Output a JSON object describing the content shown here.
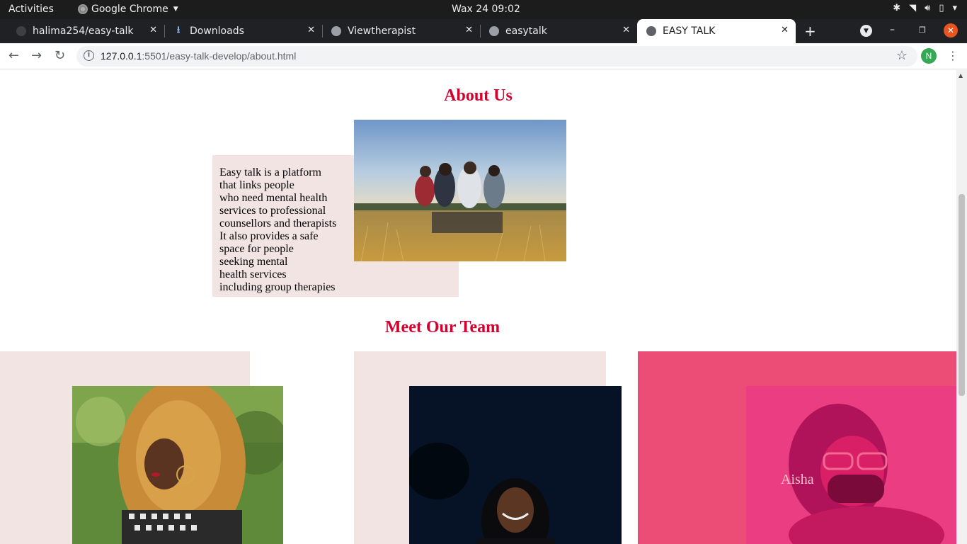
{
  "topbar": {
    "activities": "Activities",
    "app_name": "Google Chrome",
    "clock": "Wax 24  09:02"
  },
  "tabs": [
    {
      "title": "halima254/easy-talk",
      "icon": "github-icon"
    },
    {
      "title": "Downloads",
      "icon": "download-icon"
    },
    {
      "title": "Viewtherapist",
      "icon": "globe-icon"
    },
    {
      "title": "easytalk",
      "icon": "globe-icon"
    },
    {
      "title": "EASY TALK",
      "icon": "globe-icon",
      "active": true
    }
  ],
  "toolbar": {
    "url_host": "127.0.0.1",
    "url_rest": ":5501/easy-talk-develop/about.html",
    "profile_initial": "N"
  },
  "page": {
    "about_title": "About Us",
    "about_text": "Easy talk is a platform\nthat links people\nwho need mental health\nservices to professional\ncounsellors and therapists\nIt also provides a safe\nspace for people\nseeking mental\nhealth services\nincluding group therapies",
    "team_title": "Meet Our Team",
    "member_name": "Aisha"
  },
  "colors": {
    "accent": "#d6002e",
    "card_bg": "#f3e4e4",
    "card_highlight": "#ec4d77"
  }
}
